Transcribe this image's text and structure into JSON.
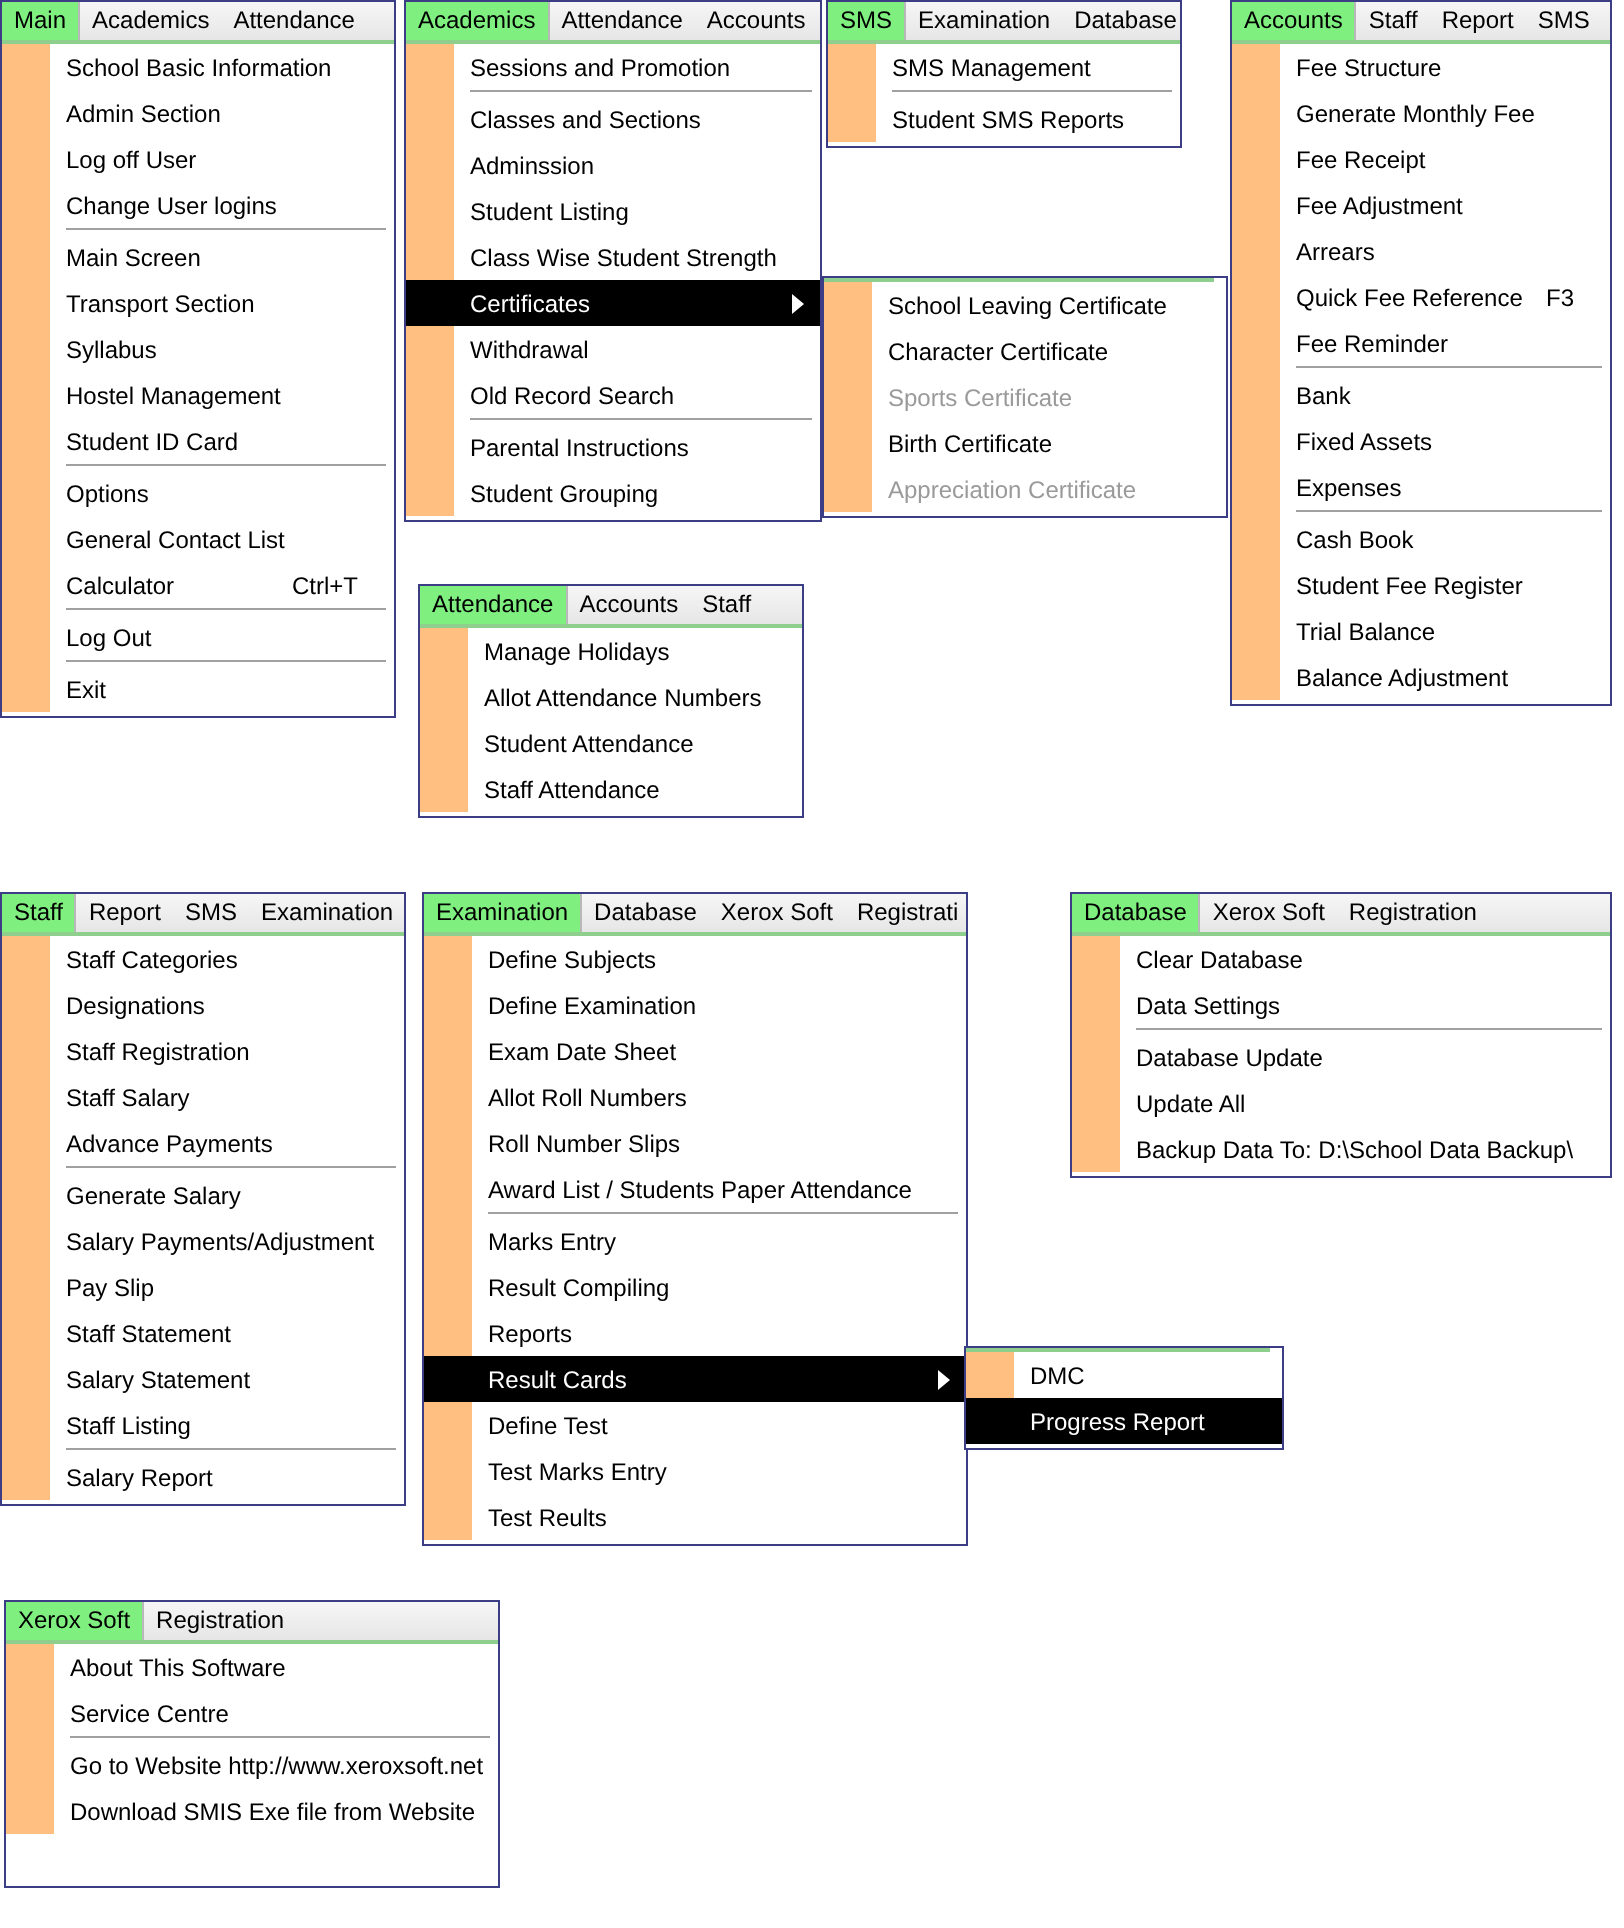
{
  "panels": [
    {
      "menubar": [
        {
          "label": "Main",
          "selected": true
        },
        {
          "label": "Academics",
          "selected": false
        },
        {
          "label": "Attendance",
          "selected": false
        }
      ],
      "items": [
        {
          "kind": "item",
          "label": "School Basic Information",
          "highlighted": false
        },
        {
          "kind": "item",
          "label": "Admin Section",
          "highlighted": false
        },
        {
          "kind": "item",
          "label": "Log off  User",
          "highlighted": false
        },
        {
          "kind": "item",
          "label": "Change User logins",
          "highlighted": false
        },
        {
          "kind": "separator"
        },
        {
          "kind": "item",
          "label": "Main Screen",
          "highlighted": false
        },
        {
          "kind": "item",
          "label": "Transport Section",
          "highlighted": false
        },
        {
          "kind": "item",
          "label": "Syllabus",
          "highlighted": false
        },
        {
          "kind": "item",
          "label": "Hostel Management",
          "highlighted": false
        },
        {
          "kind": "item",
          "label": "Student ID Card",
          "highlighted": false
        },
        {
          "kind": "separator"
        },
        {
          "kind": "item",
          "label": "Options",
          "highlighted": false
        },
        {
          "kind": "item",
          "label": "General Contact List",
          "highlighted": false
        },
        {
          "kind": "item",
          "label": "Calculator",
          "shortcut": "Ctrl+T",
          "highlighted": false
        },
        {
          "kind": "separator"
        },
        {
          "kind": "item",
          "label": "Log Out",
          "highlighted": false
        },
        {
          "kind": "separator"
        },
        {
          "kind": "item",
          "label": "Exit",
          "highlighted": false
        }
      ]
    },
    {
      "menubar": [
        {
          "label": "Academics",
          "selected": true
        },
        {
          "label": "Attendance",
          "selected": false
        },
        {
          "label": "Accounts",
          "selected": false
        }
      ],
      "items": [
        {
          "kind": "item",
          "label": "Sessions and Promotion",
          "highlighted": false
        },
        {
          "kind": "separator"
        },
        {
          "kind": "item",
          "label": "Classes and Sections",
          "highlighted": false
        },
        {
          "kind": "item",
          "label": "Adminssion",
          "highlighted": false
        },
        {
          "kind": "item",
          "label": "Student Listing",
          "highlighted": false
        },
        {
          "kind": "item",
          "label": "Class Wise Student Strength",
          "highlighted": false
        },
        {
          "kind": "item",
          "label": "Certificates",
          "highlighted": true,
          "submenu": true
        },
        {
          "kind": "item",
          "label": "Withdrawal",
          "highlighted": false
        },
        {
          "kind": "item",
          "label": "Old Record Search",
          "highlighted": false
        },
        {
          "kind": "separator"
        },
        {
          "kind": "item",
          "label": "Parental Instructions",
          "highlighted": false
        },
        {
          "kind": "item",
          "label": "Student Grouping",
          "highlighted": false
        }
      ]
    },
    {
      "menubar": [
        {
          "label": "SMS",
          "selected": true
        },
        {
          "label": "Examination",
          "selected": false
        },
        {
          "label": "Database",
          "selected": false
        }
      ],
      "items": [
        {
          "kind": "item",
          "label": "SMS Management",
          "highlighted": false
        },
        {
          "kind": "separator"
        },
        {
          "kind": "item",
          "label": "Student SMS Reports",
          "highlighted": false
        }
      ]
    },
    {
      "items": [
        {
          "kind": "item",
          "label": "School Leaving Certificate",
          "highlighted": false,
          "disabled": false
        },
        {
          "kind": "item",
          "label": "Character Certificate",
          "highlighted": false,
          "disabled": false
        },
        {
          "kind": "item",
          "label": "Sports Certificate",
          "highlighted": false,
          "disabled": true
        },
        {
          "kind": "item",
          "label": "Birth Certificate",
          "highlighted": false,
          "disabled": false
        },
        {
          "kind": "item",
          "label": "Appreciation Certificate",
          "highlighted": false,
          "disabled": true
        }
      ]
    },
    {
      "menubar": [
        {
          "label": "Accounts",
          "selected": true
        },
        {
          "label": "Staff",
          "selected": false
        },
        {
          "label": "Report",
          "selected": false
        },
        {
          "label": "SMS",
          "selected": false
        }
      ],
      "items": [
        {
          "kind": "item",
          "label": "Fee Structure",
          "highlighted": false
        },
        {
          "kind": "item",
          "label": "Generate Monthly Fee",
          "highlighted": false
        },
        {
          "kind": "item",
          "label": "Fee Receipt",
          "highlighted": false
        },
        {
          "kind": "item",
          "label": "Fee Adjustment",
          "highlighted": false
        },
        {
          "kind": "item",
          "label": "Arrears",
          "highlighted": false
        },
        {
          "kind": "item",
          "label": "Quick Fee Reference",
          "shortcut": "F3",
          "highlighted": false
        },
        {
          "kind": "item",
          "label": "Fee Reminder",
          "highlighted": false
        },
        {
          "kind": "separator"
        },
        {
          "kind": "item",
          "label": "Bank",
          "highlighted": false
        },
        {
          "kind": "item",
          "label": "Fixed Assets",
          "highlighted": false
        },
        {
          "kind": "item",
          "label": "Expenses",
          "highlighted": false
        },
        {
          "kind": "separator"
        },
        {
          "kind": "item",
          "label": "Cash Book",
          "highlighted": false
        },
        {
          "kind": "item",
          "label": "Student Fee Register",
          "highlighted": false
        },
        {
          "kind": "item",
          "label": "Trial Balance",
          "highlighted": false
        },
        {
          "kind": "item",
          "label": "Balance Adjustment",
          "highlighted": false
        }
      ]
    },
    {
      "menubar": [
        {
          "label": "Attendance",
          "selected": true
        },
        {
          "label": "Accounts",
          "selected": false
        },
        {
          "label": "Staff",
          "selected": false
        }
      ],
      "items": [
        {
          "kind": "item",
          "label": "Manage Holidays",
          "highlighted": false
        },
        {
          "kind": "item",
          "label": "Allot Attendance Numbers",
          "highlighted": false
        },
        {
          "kind": "item",
          "label": "Student Attendance",
          "highlighted": false
        },
        {
          "kind": "item",
          "label": "Staff Attendance",
          "highlighted": false
        }
      ]
    },
    {
      "menubar": [
        {
          "label": "Staff",
          "selected": true
        },
        {
          "label": "Report",
          "selected": false
        },
        {
          "label": "SMS",
          "selected": false
        },
        {
          "label": "Examination",
          "selected": false
        }
      ],
      "items": [
        {
          "kind": "item",
          "label": "Staff Categories",
          "highlighted": false
        },
        {
          "kind": "item",
          "label": "Designations",
          "highlighted": false
        },
        {
          "kind": "item",
          "label": "Staff Registration",
          "highlighted": false
        },
        {
          "kind": "item",
          "label": "Staff Salary",
          "highlighted": false
        },
        {
          "kind": "item",
          "label": "Advance Payments",
          "highlighted": false
        },
        {
          "kind": "separator"
        },
        {
          "kind": "item",
          "label": "Generate Salary",
          "highlighted": false
        },
        {
          "kind": "item",
          "label": "Salary Payments/Adjustment",
          "highlighted": false
        },
        {
          "kind": "item",
          "label": "Pay Slip",
          "highlighted": false
        },
        {
          "kind": "item",
          "label": "Staff Statement",
          "highlighted": false
        },
        {
          "kind": "item",
          "label": "Salary Statement",
          "highlighted": false
        },
        {
          "kind": "item",
          "label": "Staff Listing",
          "highlighted": false
        },
        {
          "kind": "separator"
        },
        {
          "kind": "item",
          "label": "Salary Report",
          "highlighted": false
        }
      ]
    },
    {
      "menubar": [
        {
          "label": "Examination",
          "selected": true
        },
        {
          "label": "Database",
          "selected": false
        },
        {
          "label": "Xerox Soft",
          "selected": false
        },
        {
          "label": "Registrati",
          "selected": false
        }
      ],
      "items": [
        {
          "kind": "item",
          "label": "Define Subjects",
          "highlighted": false
        },
        {
          "kind": "item",
          "label": "Define Examination",
          "highlighted": false
        },
        {
          "kind": "item",
          "label": "Exam Date Sheet",
          "highlighted": false
        },
        {
          "kind": "item",
          "label": "Allot Roll Numbers",
          "highlighted": false
        },
        {
          "kind": "item",
          "label": "Roll Number Slips",
          "highlighted": false
        },
        {
          "kind": "item",
          "label": "Award List / Students Paper Attendance",
          "highlighted": false
        },
        {
          "kind": "separator"
        },
        {
          "kind": "item",
          "label": "Marks Entry",
          "highlighted": false
        },
        {
          "kind": "item",
          "label": "Result Compiling",
          "highlighted": false
        },
        {
          "kind": "item",
          "label": "Reports",
          "highlighted": false
        },
        {
          "kind": "item",
          "label": "Result Cards",
          "highlighted": true,
          "submenu": true
        },
        {
          "kind": "item",
          "label": "Define Test",
          "highlighted": false
        },
        {
          "kind": "item",
          "label": "Test Marks Entry",
          "highlighted": false
        },
        {
          "kind": "item",
          "label": "Test Reults",
          "highlighted": false
        }
      ]
    },
    {
      "menubar": [
        {
          "label": "Database",
          "selected": true
        },
        {
          "label": "Xerox Soft",
          "selected": false
        },
        {
          "label": "Registration",
          "selected": false
        }
      ],
      "items": [
        {
          "kind": "item",
          "label": "Clear Database",
          "highlighted": false
        },
        {
          "kind": "item",
          "label": "Data Settings",
          "highlighted": false
        },
        {
          "kind": "separator"
        },
        {
          "kind": "item",
          "label": "Database Update",
          "highlighted": false
        },
        {
          "kind": "item",
          "label": "Update All",
          "highlighted": false
        },
        {
          "kind": "item",
          "label": "Backup Data To: D:\\School Data Backup\\",
          "highlighted": false
        }
      ]
    },
    {
      "items": [
        {
          "kind": "item",
          "label": "DMC",
          "highlighted": false
        },
        {
          "kind": "item",
          "label": "Progress Report",
          "highlighted": true
        }
      ]
    },
    {
      "menubar": [
        {
          "label": "Xerox Soft",
          "selected": true
        },
        {
          "label": "Registration",
          "selected": false
        }
      ],
      "items": [
        {
          "kind": "item",
          "label": "About This Software",
          "highlighted": false
        },
        {
          "kind": "item",
          "label": "Service Centre",
          "highlighted": false
        },
        {
          "kind": "separator"
        },
        {
          "kind": "item",
          "label": "Go to Website http://www.xeroxsoft.net",
          "highlighted": false
        },
        {
          "kind": "item",
          "label": "Download SMIS Exe file from Website",
          "highlighted": false
        }
      ]
    }
  ]
}
